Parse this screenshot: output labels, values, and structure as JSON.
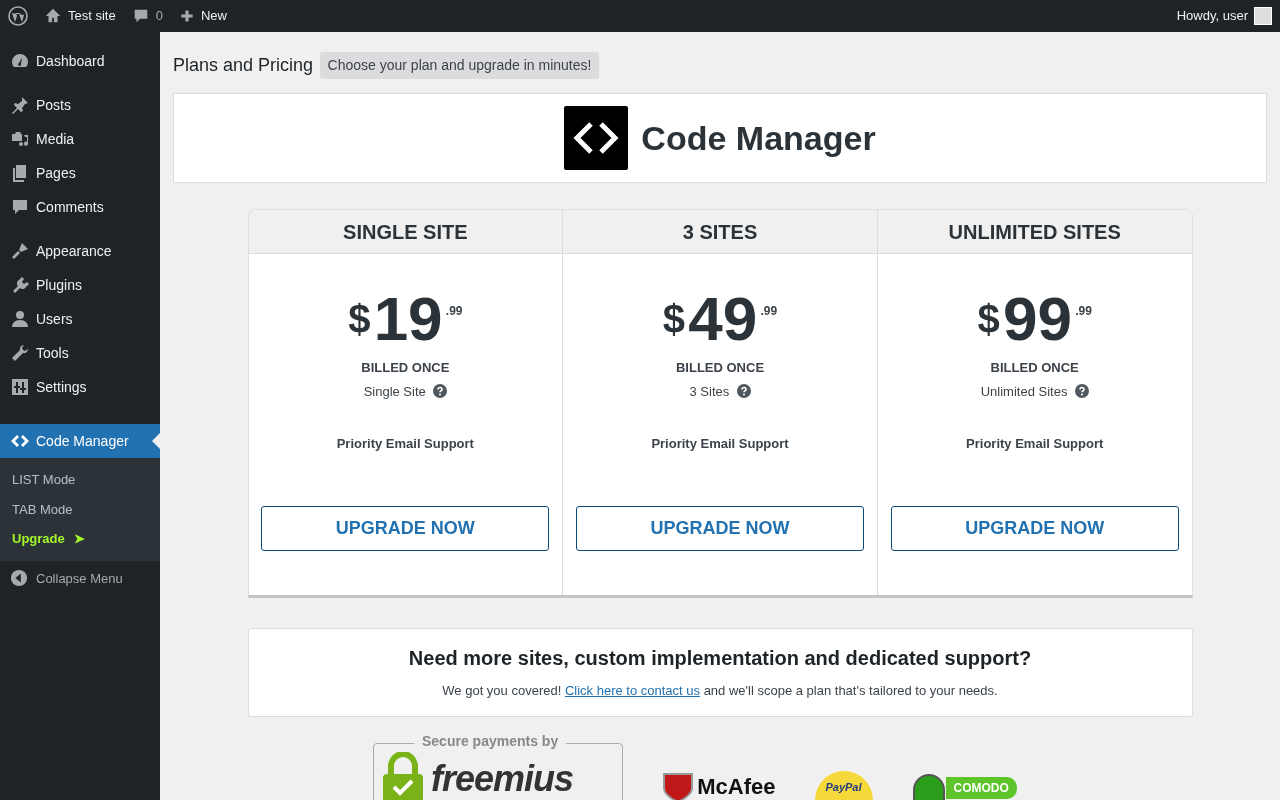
{
  "admin_bar": {
    "site": "Test site",
    "comments": "0",
    "new": "New",
    "greeting": "Howdy, user"
  },
  "sidebar": {
    "groups": [
      [
        {
          "label": "Dashboard",
          "selected": false
        }
      ],
      [
        {
          "label": "Posts",
          "selected": false
        },
        {
          "label": "Media",
          "selected": false
        },
        {
          "label": "Pages",
          "selected": false
        },
        {
          "label": "Comments",
          "selected": false
        }
      ],
      [
        {
          "label": "Appearance",
          "selected": false
        },
        {
          "label": "Plugins",
          "selected": false
        },
        {
          "label": "Users",
          "selected": false
        },
        {
          "label": "Tools",
          "selected": false
        },
        {
          "label": "Settings",
          "selected": false
        }
      ],
      [
        {
          "label": "Code Manager",
          "selected": true
        }
      ]
    ],
    "submenu": [
      {
        "label": "LIST Mode",
        "kind": "link"
      },
      {
        "label": "TAB Mode",
        "kind": "link"
      },
      {
        "label": "Upgrade",
        "kind": "upgrade",
        "arrow": "➤"
      }
    ],
    "collapse": "Collapse Menu"
  },
  "page": {
    "title": "Plans and Pricing",
    "subtitle": "Choose your plan and upgrade in minutes!",
    "product": "Code Manager"
  },
  "plans": [
    {
      "name": "SINGLE SITE",
      "currency": "$",
      "price": "19",
      "cents": ".99",
      "billing": "BILLED ONCE",
      "sites": "Single Site",
      "feature": "Priority Email Support",
      "button": "UPGRADE NOW"
    },
    {
      "name": "3 SITES",
      "currency": "$",
      "price": "49",
      "cents": ".99",
      "billing": "BILLED ONCE",
      "sites": "3 Sites",
      "feature": "Priority Email Support",
      "button": "UPGRADE NOW"
    },
    {
      "name": "UNLIMITED SITES",
      "currency": "$",
      "price": "99",
      "cents": ".99",
      "billing": "BILLED ONCE",
      "sites": "Unlimited Sites",
      "feature": "Priority Email Support",
      "button": "UPGRADE NOW"
    }
  ],
  "contact": {
    "heading": "Need more sites, custom implementation and dedicated support?",
    "before": "We got you covered!",
    "link": "Click here to contact us",
    "after": "and we'll scope a plan that's tailored to your needs."
  },
  "badges": {
    "freemius_caption": "Secure payments by",
    "freemius": "freemius",
    "mcafee": "McAfee",
    "paypal": "PayPal",
    "comodo": "COMODO"
  }
}
